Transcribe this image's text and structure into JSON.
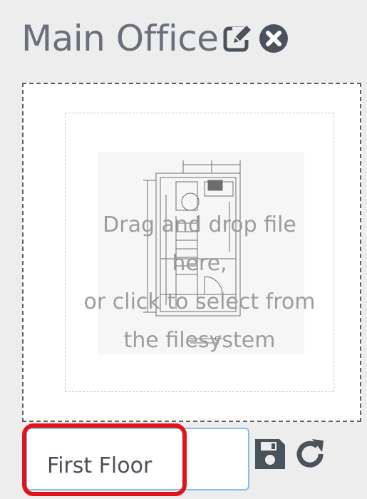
{
  "header": {
    "title": "Main Office",
    "edit_icon": "edit-icon",
    "remove_icon": "remove-circle-icon"
  },
  "dropzone": {
    "line1": "Drag and drop file here,",
    "line2": "or click to select from",
    "line3": "the filesystem",
    "preview": "floor-plan-image"
  },
  "floor": {
    "name_value": "First Floor",
    "save_icon": "save-icon",
    "reset_icon": "refresh-icon"
  },
  "colors": {
    "title": "#6a7079",
    "background": "#ededed",
    "highlight": "#e3131b",
    "input_border": "#84bde8"
  }
}
